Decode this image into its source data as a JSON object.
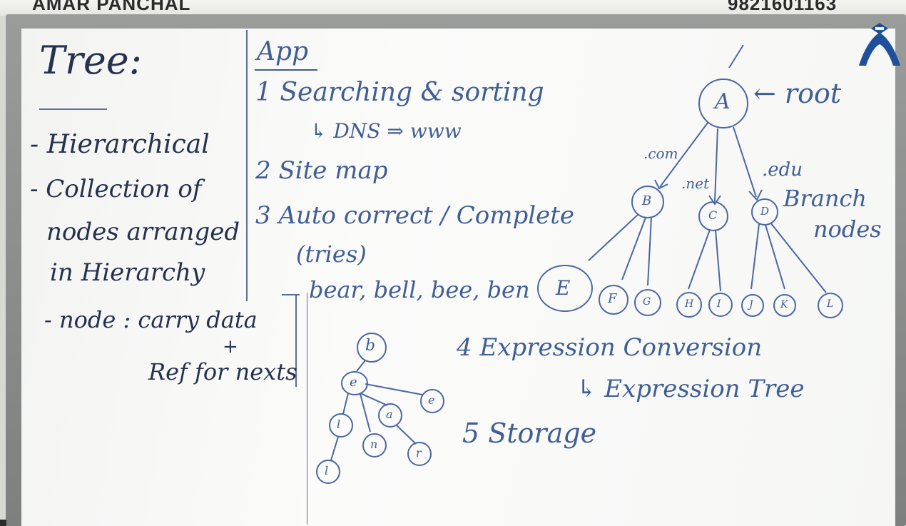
{
  "header": {
    "left_text": "AMAR PANCHAL",
    "right_text": "9821601163"
  },
  "left_column": {
    "title": "Tree:",
    "points": [
      "- Hierarchical",
      "- Collection of",
      "nodes arranged",
      "in Hierarchy",
      "- node : carry data",
      "+",
      "Ref for nexts"
    ]
  },
  "applications": {
    "heading": "App",
    "items": [
      "1 Searching & sorting",
      "↳ DNS ⇒ www",
      "2 Site map",
      "3 Auto correct / Complete",
      "(tries)",
      "bear, bell, bee, ben",
      "4 Expression Conversion",
      "↳ Expression Tree",
      "5 Storage"
    ]
  },
  "root_tree": {
    "root_label": "A",
    "root_annotation": "← root",
    "edge_labels": [
      ".com",
      ".net",
      ".edu"
    ],
    "branch_annotation_1": "Branch",
    "branch_annotation_2": "nodes",
    "branch_nodes": [
      "B",
      "C",
      "D"
    ],
    "leaf_nodes": [
      "E",
      "F",
      "G",
      "H",
      "I",
      "J",
      "K",
      "L"
    ]
  },
  "trie_tree": {
    "nodes": [
      "b",
      "e",
      "a",
      "l",
      "e",
      "n",
      "r",
      "l"
    ]
  }
}
